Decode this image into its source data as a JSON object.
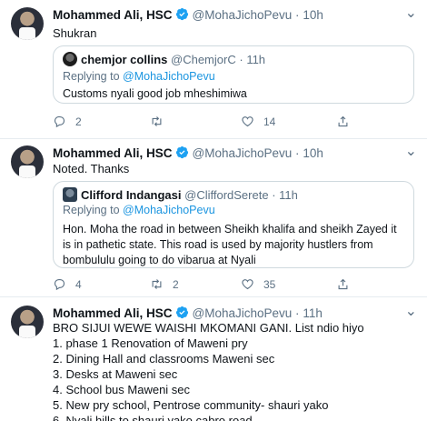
{
  "tweets": [
    {
      "author": {
        "name": "Mohammed Ali, HSC",
        "handle": "@MohaJichoPevu",
        "time": "10h"
      },
      "separator": "·",
      "text": "Shukran",
      "quote": {
        "name": "chemjor collins",
        "handle": "@ChemjorC",
        "time": "11h",
        "replying_prefix": "Replying to",
        "replying_to": "@MohaJichoPevu",
        "text": "Customs nyali good job mheshimiwa"
      },
      "stats": {
        "replies": "2",
        "retweets": "",
        "likes": "14"
      }
    },
    {
      "author": {
        "name": "Mohammed Ali, HSC",
        "handle": "@MohaJichoPevu",
        "time": "10h"
      },
      "separator": "·",
      "text": "Noted. Thanks",
      "quote": {
        "name": "Clifford Indangasi",
        "handle": "@CliffordSerete",
        "time": "11h",
        "replying_prefix": "Replying to",
        "replying_to": "@MohaJichoPevu",
        "text": "Hon. Moha the road in between Sheikh khalifa and sheikh Zayed it is in pathetic state. This road is used by majority hustlers from bombululu going to do  vibarua at Nyali"
      },
      "stats": {
        "replies": "4",
        "retweets": "2",
        "likes": "35"
      }
    },
    {
      "author": {
        "name": "Mohammed Ali, HSC",
        "handle": "@MohaJichoPevu",
        "time": "11h"
      },
      "separator": "·",
      "lines": [
        "BRO SIJUI WEWE WAISHI MKOMANI GANI. List ndio hiyo",
        "1. phase 1 Renovation of Maweni pry",
        "2. Dining Hall and  classrooms Maweni sec",
        "3. Desks at Maweni sec",
        "4. School bus Maweni sec",
        "5. New pry school, Pentrose community- shauri yako",
        "6. Nyali hills to shauri yako cabro road"
      ]
    }
  ],
  "icons": {
    "verified": "verified-badge-icon",
    "reply": "reply-icon",
    "retweet": "retweet-icon",
    "like": "heart-icon",
    "share": "share-icon",
    "more": "more-dots-icon"
  },
  "colors": {
    "accent": "#1b95e0",
    "muted": "#5b7083",
    "border": "#cfd9de"
  }
}
